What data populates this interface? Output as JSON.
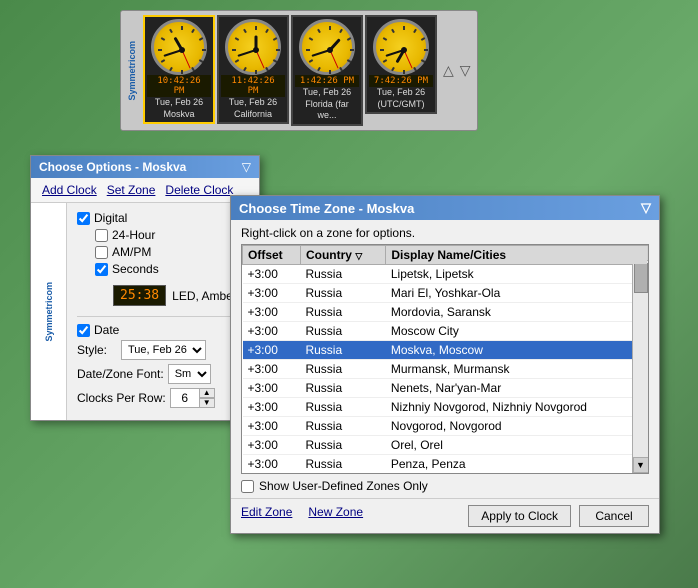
{
  "app": {
    "name": "Symmetricom"
  },
  "clock_strip": {
    "clocks": [
      {
        "id": "clock1",
        "time": "10:42:26 PM",
        "date": "Tue, Feb 26",
        "label": "Moskva",
        "selected": true,
        "hour_angle": 330,
        "min_angle": 252,
        "sec_angle": 156
      },
      {
        "id": "clock2",
        "time": "11:42:26 PM",
        "date": "Tue, Feb 26",
        "label": "California",
        "selected": false,
        "hour_angle": 0,
        "min_angle": 252,
        "sec_angle": 156
      },
      {
        "id": "clock3",
        "time": "1:42:26 PM",
        "date": "Tue, Feb 26",
        "label": "Florida (far we...",
        "selected": false,
        "hour_angle": 42,
        "min_angle": 252,
        "sec_angle": 156
      },
      {
        "id": "clock4",
        "time": "7:42:26 PM",
        "date": "Tue, Feb 26",
        "label": "(UTC/GMT)",
        "selected": false,
        "hour_angle": 210,
        "min_angle": 252,
        "sec_angle": 156
      }
    ]
  },
  "options_dialog": {
    "title": "Choose Options - Moskva",
    "menu": [
      "Add Clock",
      "Set Zone",
      "Delete Clock"
    ],
    "digital_checked": true,
    "digital_label": "Digital",
    "hour24_checked": false,
    "hour24_label": "24-Hour",
    "ampm_checked": false,
    "ampm_label": "AM/PM",
    "seconds_checked": true,
    "seconds_label": "Seconds",
    "led_time": "25:38",
    "led_style": "LED, Amber",
    "date_checked": true,
    "date_label": "Date",
    "style_label": "Style:",
    "style_value": "Tue, Feb 26",
    "font_label": "Date/Zone Font:",
    "font_value": "Sm",
    "rows_label": "Clocks Per Row:",
    "rows_value": "6"
  },
  "timezone_dialog": {
    "title": "Choose Time Zone - Moskva",
    "subtitle": "Right-click on a zone for options.",
    "columns": [
      "Offset",
      "Country",
      "Display Name/Cities"
    ],
    "country_sort_arrow": "▽",
    "rows": [
      {
        "offset": "+3:00",
        "country": "Russia",
        "display": "Lipetsk, Lipetsk",
        "selected": false
      },
      {
        "offset": "+3:00",
        "country": "Russia",
        "display": "Mari El, Yoshkar-Ola",
        "selected": false
      },
      {
        "offset": "+3:00",
        "country": "Russia",
        "display": "Mordovia, Saransk",
        "selected": false
      },
      {
        "offset": "+3:00",
        "country": "Russia",
        "display": "Moscow City",
        "selected": false
      },
      {
        "offset": "+3:00",
        "country": "Russia",
        "display": "Moskva, Moscow",
        "selected": true
      },
      {
        "offset": "+3:00",
        "country": "Russia",
        "display": "Murmansk, Murmansk",
        "selected": false
      },
      {
        "offset": "+3:00",
        "country": "Russia",
        "display": "Nenets, Nar'yan-Mar",
        "selected": false
      },
      {
        "offset": "+3:00",
        "country": "Russia",
        "display": "Nizhniy Novgorod, Nizhniy Novgorod",
        "selected": false
      },
      {
        "offset": "+3:00",
        "country": "Russia",
        "display": "Novgorod, Novgorod",
        "selected": false
      },
      {
        "offset": "+3:00",
        "country": "Russia",
        "display": "Orel, Orel",
        "selected": false
      },
      {
        "offset": "+3:00",
        "country": "Russia",
        "display": "Penza, Penza",
        "selected": false
      }
    ],
    "show_user_zones_label": "Show User-Defined Zones Only",
    "show_user_zones_checked": false,
    "footer_links": [
      "Edit Zone",
      "New Zone"
    ],
    "footer_btns": [
      "Apply to Clock",
      "Cancel"
    ]
  }
}
